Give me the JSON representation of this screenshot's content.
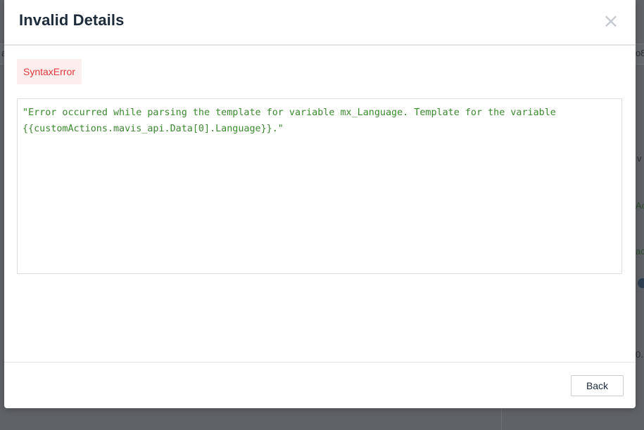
{
  "modal": {
    "title": "Invalid Details",
    "close_glyph": "×",
    "close_icon": "close-icon",
    "error_type": "SyntaxError",
    "error_message": "\"Error occurred while parsing the template for variable mx_Language. Template for the variable {{customActions.mavis_api.Data[0].Language}}.\"",
    "back_label": "Back"
  },
  "background": {
    "fragments": [
      "a",
      "o8",
      "v",
      "Ac",
      "ac",
      "0."
    ]
  },
  "colors": {
    "overlay": "#5b5e63",
    "title": "#1d2b3a",
    "error_badge_bg": "#fdeeee",
    "error_badge_text": "#e0393e",
    "error_message_text": "#3a8a2e",
    "border": "#dcdfe2"
  }
}
